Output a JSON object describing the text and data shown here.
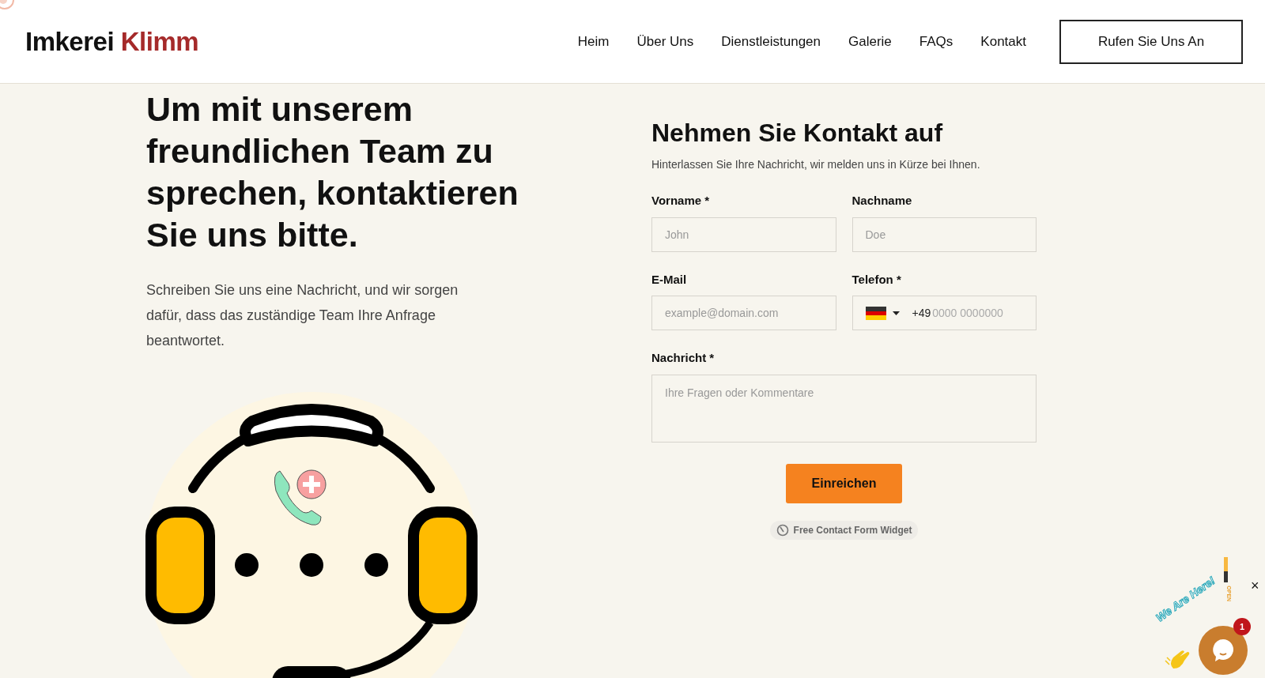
{
  "header": {
    "logo": {
      "first": "Imkerei",
      "second": "Klimm"
    },
    "nav": [
      {
        "label": "Heim"
      },
      {
        "label": "Über Uns"
      },
      {
        "label": "Dienstleistungen"
      },
      {
        "label": "Galerie"
      },
      {
        "label": "FAQs"
      },
      {
        "label": "Kontakt"
      }
    ],
    "cta": "Rufen Sie Uns An"
  },
  "intro": {
    "heading": "Um mit unserem freundlichen Team zu sprechen, kontaktieren Sie uns bitte.",
    "text": "Schreiben Sie uns eine Nachricht, und wir sorgen dafür, dass das zuständige Team Ihre Anfrage beantwortet."
  },
  "form": {
    "title": "Nehmen Sie Kontakt auf",
    "subtitle": "Hinterlassen Sie Ihre Nachricht, wir melden uns in Kürze bei Ihnen.",
    "fields": [
      {
        "kind": "text",
        "label": "Vorname *",
        "placeholder": "John"
      },
      {
        "kind": "text",
        "label": "Nachname",
        "placeholder": "Doe"
      },
      {
        "kind": "text",
        "label": "E-Mail",
        "placeholder": "example@domain.com"
      },
      {
        "kind": "phone",
        "label": "Telefon *",
        "prefix": "+49",
        "placeholder": "0000 0000000"
      },
      {
        "kind": "textarea",
        "label": "Nachricht *",
        "placeholder": "Ihre Fragen oder Kommentare"
      }
    ],
    "submit": "Einreichen",
    "badge": "Free Contact Form Widget"
  },
  "chat_widget": {
    "greeting": "We Are Here!",
    "status": "OPEN",
    "unread": "1",
    "close": "×"
  }
}
